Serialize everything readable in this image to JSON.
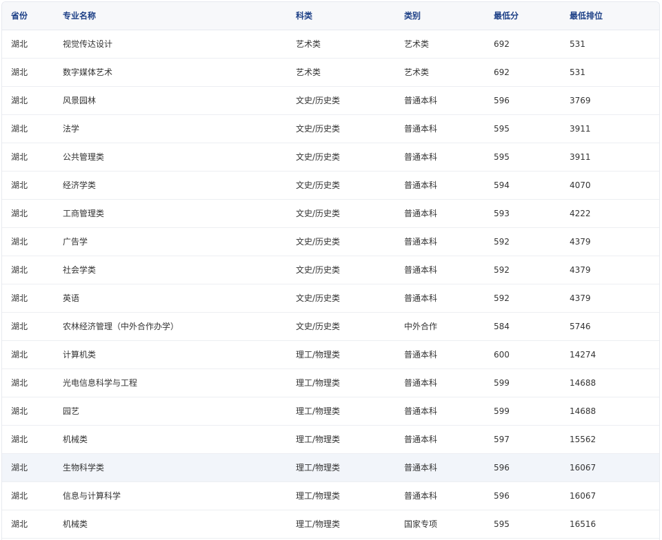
{
  "table": {
    "headers": [
      "省份",
      "专业名称",
      "科类",
      "类别",
      "最低分",
      "最低排位"
    ],
    "rows": [
      [
        "湖北",
        "视觉传达设计",
        "艺术类",
        "艺术类",
        "692",
        "531"
      ],
      [
        "湖北",
        "数字媒体艺术",
        "艺术类",
        "艺术类",
        "692",
        "531"
      ],
      [
        "湖北",
        "风景园林",
        "文史/历史类",
        "普通本科",
        "596",
        "3769"
      ],
      [
        "湖北",
        "法学",
        "文史/历史类",
        "普通本科",
        "595",
        "3911"
      ],
      [
        "湖北",
        "公共管理类",
        "文史/历史类",
        "普通本科",
        "595",
        "3911"
      ],
      [
        "湖北",
        "经济学类",
        "文史/历史类",
        "普通本科",
        "594",
        "4070"
      ],
      [
        "湖北",
        "工商管理类",
        "文史/历史类",
        "普通本科",
        "593",
        "4222"
      ],
      [
        "湖北",
        "广告学",
        "文史/历史类",
        "普通本科",
        "592",
        "4379"
      ],
      [
        "湖北",
        "社会学类",
        "文史/历史类",
        "普通本科",
        "592",
        "4379"
      ],
      [
        "湖北",
        "英语",
        "文史/历史类",
        "普通本科",
        "592",
        "4379"
      ],
      [
        "湖北",
        "农林经济管理（中外合作办学）",
        "文史/历史类",
        "中外合作",
        "584",
        "5746"
      ],
      [
        "湖北",
        "计算机类",
        "理工/物理类",
        "普通本科",
        "600",
        "14274"
      ],
      [
        "湖北",
        "光电信息科学与工程",
        "理工/物理类",
        "普通本科",
        "599",
        "14688"
      ],
      [
        "湖北",
        "园艺",
        "理工/物理类",
        "普通本科",
        "599",
        "14688"
      ],
      [
        "湖北",
        "机械类",
        "理工/物理类",
        "普通本科",
        "597",
        "15562"
      ],
      [
        "湖北",
        "生物科学类",
        "理工/物理类",
        "普通本科",
        "596",
        "16067"
      ],
      [
        "湖北",
        "信息与计算科学",
        "理工/物理类",
        "普通本科",
        "596",
        "16067"
      ],
      [
        "湖北",
        "机械类",
        "理工/物理类",
        "国家专项",
        "595",
        "16516"
      ]
    ],
    "highlighted_row_index": 15
  },
  "colors": {
    "header_text": "#1c3f86",
    "header_bg": "#f7f8fa",
    "row_hover_bg": "#f2f5fa",
    "body_text": "#333333",
    "border": "#e6e9ef"
  }
}
